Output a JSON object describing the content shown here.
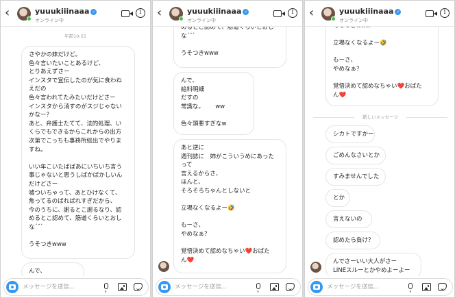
{
  "chat": {
    "username": "yuuukiiinaaa",
    "status": "オンライン中",
    "verified_mark": "✓",
    "back_glyph": "‹",
    "info_glyph": "i",
    "input_placeholder": "メッセージを送信...",
    "timestamp": "午前10:55",
    "new_messages_label": "新しいメッセージ"
  },
  "panel1": {
    "messages": [
      "さやかの妹だけど。\n色々言いたいことあるけど、\nとりあえずさー\nインスタで宣伝したのが気に食わね\nえだの\n色々言われてたみたいだけどさー\nインスタから消すのがスジじゃない\nかなー？\nあと、弁護士たてて、法的処理、い\nくらでもできるからこれからの出方\n次第でこっちも事務所総出でやりま\nすね。\n\nいい年こいたばばあにいちいち言う\n事じゃないと思うしばかばかしいん\nだけどさー\n嘘ついちゃって、あとひけなくて、\n焦ってるのばればれすぎだから、\n今のうちに、謝るとこ謝るなり、認\nめるとこ認めて、筋道くらいとおし\nな´˘`\n\nうそつきwww",
      "んで、"
    ]
  },
  "panel2": {
    "messages": [
      "めるとこ認めて、筋道くらいとおし\nな´˘`\n\nうそつきwww",
      "んで、\n給料明細\nだすの\n常識な。      ww\n\n色々頭悪すぎなw",
      "あと逆に\n週刊誌に　姉がこういうめにあった\nって\n言えるからさ、\nほんと、\nそろそろちゃんとしないと\n\n立場なくなるよー🤣\n\nもーさ、\nやめなぁ？\n\n覚悟決めて認めなちゃい❤️おばた\nん❤️"
    ]
  },
  "panel3": {
    "messages": [
      "でそつきwww\n\n立場なくなるよー🤣\n\nもーさ、\nやめなぁ？\n\n覚悟決めて認めなちゃい❤️おばた\nん❤️",
      "シカトですかー",
      "ごめんなさいとか",
      "すみませんでした",
      "とか",
      "言えないの",
      "認めたら負け？",
      "んでさーいい大人がさー\nLINEスルーとかやめよーよー"
    ]
  }
}
